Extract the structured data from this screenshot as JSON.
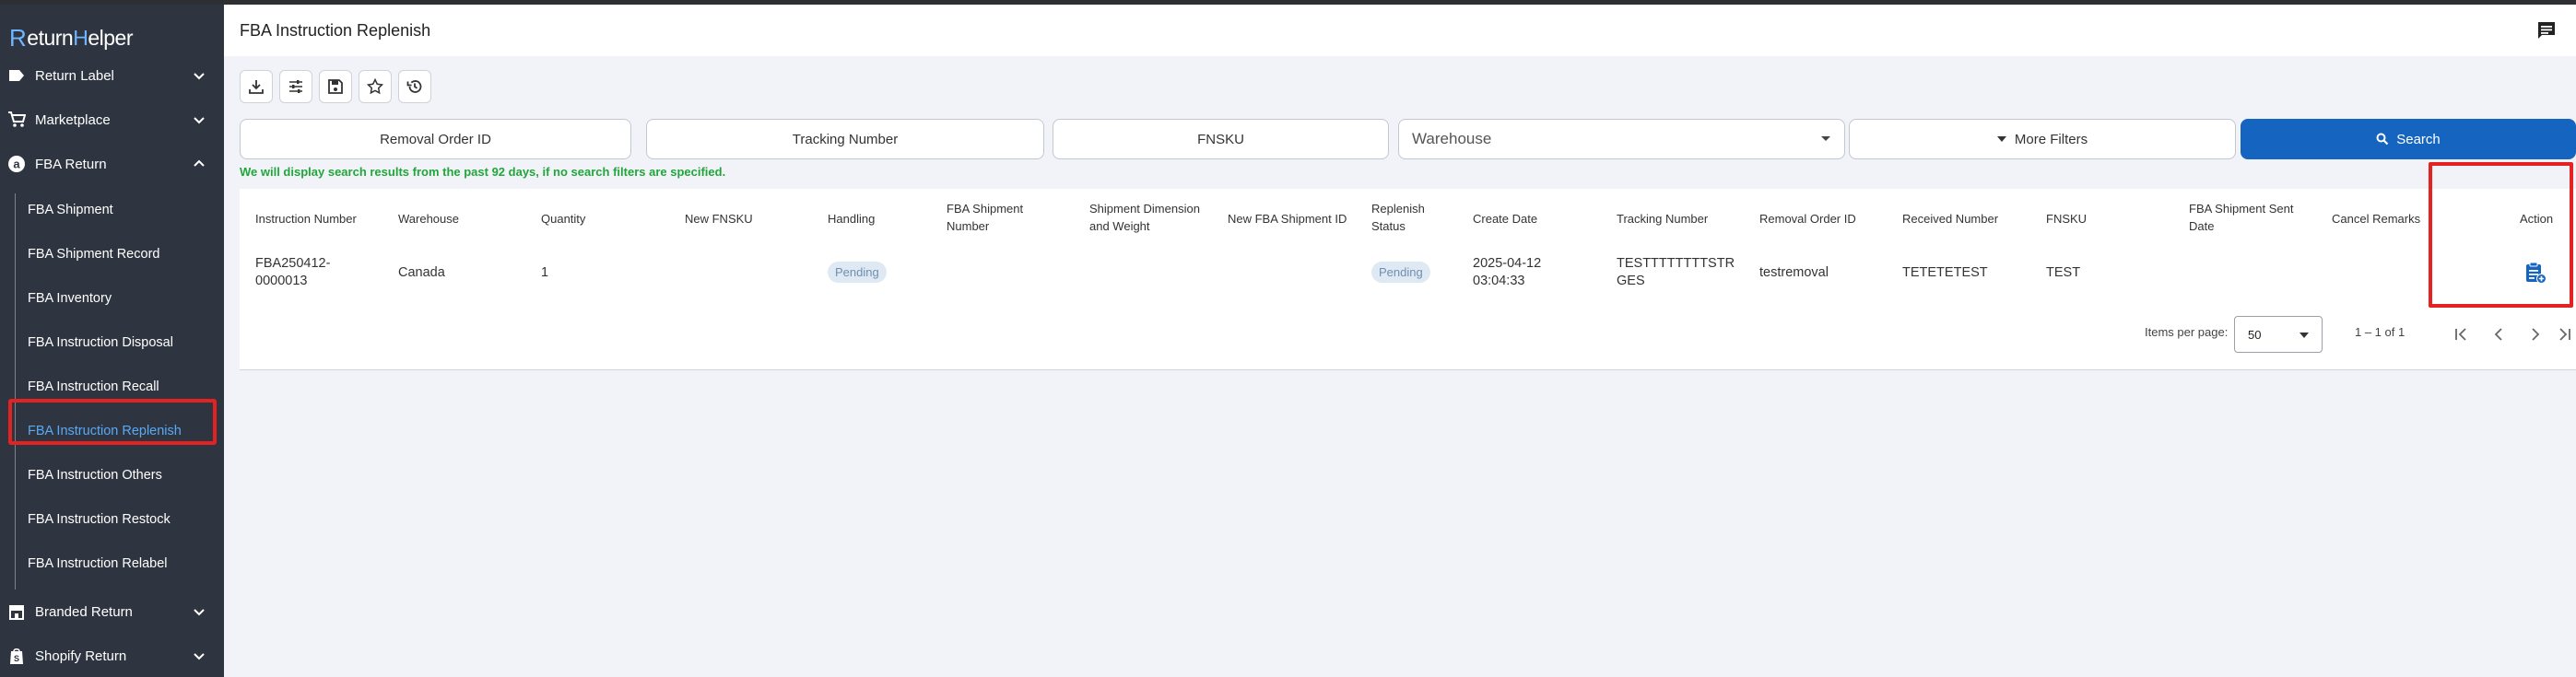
{
  "app": {
    "logo_text_1": "eturn",
    "logo_text_2": "elper",
    "logo_r": "R",
    "logo_h": "H"
  },
  "sidebar": {
    "groups": [
      {
        "label": "Return Label",
        "icon": "label-icon"
      },
      {
        "label": "Marketplace",
        "icon": "cart-icon"
      },
      {
        "label": "FBA Return",
        "icon": "amazon-icon"
      },
      {
        "label": "Branded Return",
        "icon": "store-icon"
      },
      {
        "label": "Shopify Return",
        "icon": "shopify-icon"
      }
    ],
    "items": [
      {
        "label": "FBA Shipment"
      },
      {
        "label": "FBA Shipment Record"
      },
      {
        "label": "FBA Inventory"
      },
      {
        "label": "FBA Instruction Disposal"
      },
      {
        "label": "FBA Instruction Recall"
      },
      {
        "label": "FBA Instruction Replenish"
      },
      {
        "label": "FBA Instruction Others"
      },
      {
        "label": "FBA Instruction Restock"
      },
      {
        "label": "FBA Instruction Relabel"
      }
    ]
  },
  "header": {
    "title": "FBA Instruction Replenish"
  },
  "filters": {
    "removal_order_id": "Removal Order ID",
    "tracking_number": "Tracking Number",
    "fnsku": "FNSKU",
    "warehouse": "Warehouse",
    "more_filters": "More Filters",
    "search": "Search"
  },
  "notice": "We will display search results from the past 92 days, if no search filters are specified.",
  "table": {
    "headers": {
      "instruction_number": "Instruction Number",
      "warehouse": "Warehouse",
      "quantity": "Quantity",
      "new_fnsku": "New FNSKU",
      "handling": "Handling",
      "fba_shipment_number_1": "FBA Shipment",
      "fba_shipment_number_2": "Number",
      "shipment_dimension_1": "Shipment Dimension",
      "shipment_dimension_2": "and Weight",
      "new_fba_shipment_id": "New FBA Shipment ID",
      "replenish_status_1": "Replenish",
      "replenish_status_2": "Status",
      "create_date": "Create Date",
      "tracking_number": "Tracking Number",
      "removal_order_id": "Removal Order ID",
      "received_number": "Received Number",
      "fnsku": "FNSKU",
      "fba_shipment_sent_date_1": "FBA Shipment Sent",
      "fba_shipment_sent_date_2": "Date",
      "cancel_remarks": "Cancel Remarks",
      "action": "Action"
    },
    "row": {
      "instruction_number_1": "FBA250412-",
      "instruction_number_2": "0000013",
      "warehouse": "Canada",
      "quantity": "1",
      "handling": "Pending",
      "replenish_status": "Pending",
      "create_date_1": "2025-04-12",
      "create_date_2": "03:04:33",
      "tracking_number_1": "TESTTTTTTTTSTR",
      "tracking_number_2": "GES",
      "removal_order_id": "testremoval",
      "received_number": "TETETETEST",
      "fnsku": "TEST"
    }
  },
  "pagination": {
    "items_per_page_label": "Items per page:",
    "page_size": "50",
    "range": "1 – 1 of 1"
  },
  "colors": {
    "sidebar_bg": "#2f3540",
    "accent": "#1565c0",
    "active": "#5aa9f5",
    "highlight": "#e52222",
    "notice": "#20a63a"
  }
}
